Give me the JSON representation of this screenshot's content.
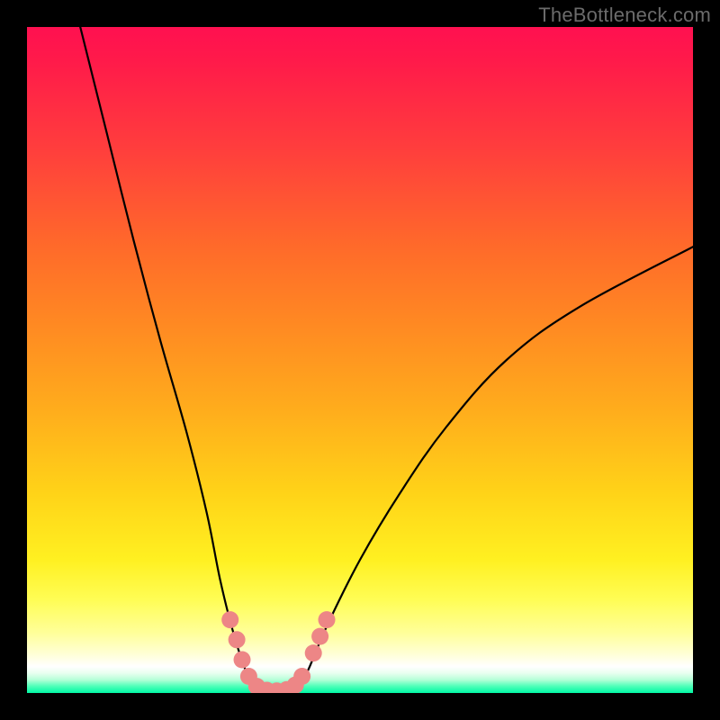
{
  "watermark_text": "TheBottleneck.com",
  "chart_data": {
    "type": "line",
    "title": "",
    "xlabel": "",
    "ylabel": "",
    "xlim": [
      0,
      100
    ],
    "ylim": [
      0,
      100
    ],
    "gradient_stops": [
      {
        "pct": 0,
        "color": "#ff1050"
      },
      {
        "pct": 18,
        "color": "#ff3d3d"
      },
      {
        "pct": 45,
        "color": "#ff8a22"
      },
      {
        "pct": 70,
        "color": "#ffd318"
      },
      {
        "pct": 86,
        "color": "#fffd55"
      },
      {
        "pct": 96,
        "color": "#ffffff"
      },
      {
        "pct": 100,
        "color": "#00f9a4"
      }
    ],
    "series": [
      {
        "name": "left-curve",
        "stroke": "#000000",
        "points": [
          {
            "x": 8,
            "y": 100
          },
          {
            "x": 12,
            "y": 84
          },
          {
            "x": 16,
            "y": 68
          },
          {
            "x": 20,
            "y": 53
          },
          {
            "x": 24,
            "y": 39
          },
          {
            "x": 27,
            "y": 27
          },
          {
            "x": 29,
            "y": 17
          },
          {
            "x": 31,
            "y": 9
          },
          {
            "x": 33,
            "y": 3
          },
          {
            "x": 35,
            "y": 0
          }
        ]
      },
      {
        "name": "right-curve",
        "stroke": "#000000",
        "points": [
          {
            "x": 40,
            "y": 0
          },
          {
            "x": 42,
            "y": 3
          },
          {
            "x": 45,
            "y": 10
          },
          {
            "x": 50,
            "y": 20
          },
          {
            "x": 56,
            "y": 30
          },
          {
            "x": 63,
            "y": 40
          },
          {
            "x": 72,
            "y": 50
          },
          {
            "x": 83,
            "y": 58
          },
          {
            "x": 100,
            "y": 67
          }
        ]
      }
    ],
    "markers": {
      "color": "#ed8686",
      "stroke": "#a74d4d",
      "points": [
        {
          "x": 30.5,
          "y": 11
        },
        {
          "x": 31.5,
          "y": 8
        },
        {
          "x": 32.3,
          "y": 5
        },
        {
          "x": 33.3,
          "y": 2.5
        },
        {
          "x": 34.5,
          "y": 1
        },
        {
          "x": 36.0,
          "y": 0.4
        },
        {
          "x": 37.5,
          "y": 0.3
        },
        {
          "x": 39.0,
          "y": 0.5
        },
        {
          "x": 40.3,
          "y": 1.2
        },
        {
          "x": 41.3,
          "y": 2.5
        },
        {
          "x": 43.0,
          "y": 6
        },
        {
          "x": 44.0,
          "y": 8.5
        },
        {
          "x": 45.0,
          "y": 11
        }
      ]
    }
  }
}
